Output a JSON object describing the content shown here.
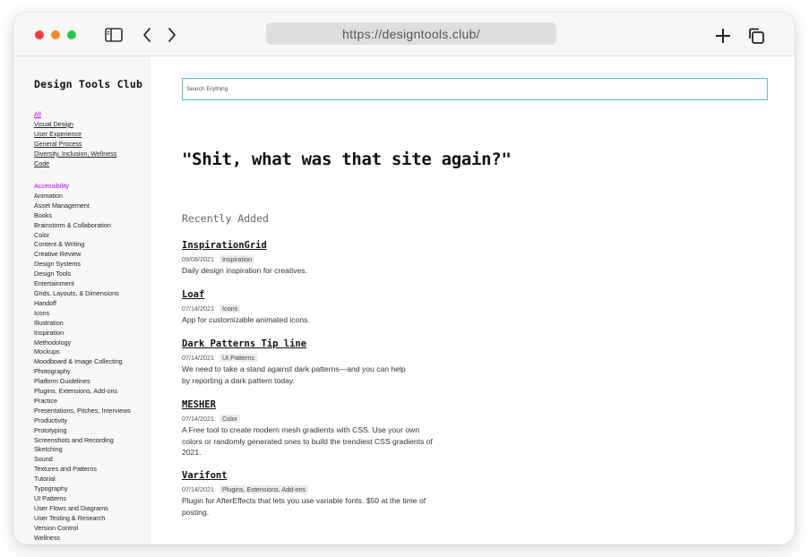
{
  "browser": {
    "url": "https://designtools.club/",
    "colors": {
      "close": "#ee3d3d",
      "minimize": "#f08a2a",
      "maximize": "#2ec44a"
    },
    "icons": [
      "sidebar-icon",
      "back-icon",
      "forward-icon",
      "new-tab-icon",
      "tabs-icon"
    ]
  },
  "sidebar": {
    "title": "Design Tools Club",
    "primary": [
      "All",
      "Visual Design",
      "User Experience",
      "General Process",
      "Diversity, Inclusion, Wellness",
      "Code"
    ],
    "categories": [
      "Accessibility",
      "Animation",
      "Asset Management",
      "Books",
      "Brainstorm & Collaboration",
      "Color",
      "Content & Writing",
      "Creative Review",
      "Design Systems",
      "Design Tools",
      "Entertainment",
      "Grids, Layouts, & Dimensions",
      "Handoff",
      "Icons",
      "Illustration",
      "Inspiration",
      "Methodology",
      "Mockups",
      "Moodboard & Image Collecting",
      "Photography",
      "Platform Guidelines",
      "Plugins, Extensions, Add-ons",
      "Practice",
      "Presentations, Pitches, Interviews",
      "Productivity",
      "Prototyping",
      "Screenshots and Recording",
      "Sketching",
      "Sound",
      "Textures and Patterns",
      "Tutorial",
      "Typography",
      "UI Patterns",
      "User Flows and Diagrams",
      "User Testing & Research",
      "Version Control",
      "Wellness"
    ],
    "active_color": "#b100ff"
  },
  "main": {
    "search_placeholder": "Search Erything",
    "headline": "\"Shit, what was that site again?\"",
    "section_title": "Recently Added",
    "accent_color": "#56c6b7",
    "entries": [
      {
        "title": "InspirationGrid",
        "date": "09/08/2021",
        "tag": "Inspiration",
        "desc": [
          "Daily design inspiration for creatives."
        ]
      },
      {
        "title": "Loaf",
        "date": "07/14/2021",
        "tag": "Icons",
        "desc": [
          "App for customizable animated icons."
        ]
      },
      {
        "title": "Dark Patterns Tip line",
        "date": "07/14/2021",
        "tag": "UI Patterns",
        "desc": [
          "We need to take a stand against dark patterns—and you can help",
          "by reporting a dark pattern today."
        ]
      },
      {
        "title": "MESHER",
        "date": "07/14/2021",
        "tag": "Color",
        "desc": [
          "A Free tool to create modern mesh gradients with CSS. Use your own",
          "colors or randomly generated ones to build the trendiest CSS gradients of",
          "2021."
        ]
      },
      {
        "title": "Varifont",
        "date": "07/14/2021",
        "tag": "Plugins, Extensions, Add-ons",
        "desc": [
          "Plugin for AfterEffects that lets you use variable fonts. $50 at the time of",
          "posting."
        ]
      }
    ]
  }
}
